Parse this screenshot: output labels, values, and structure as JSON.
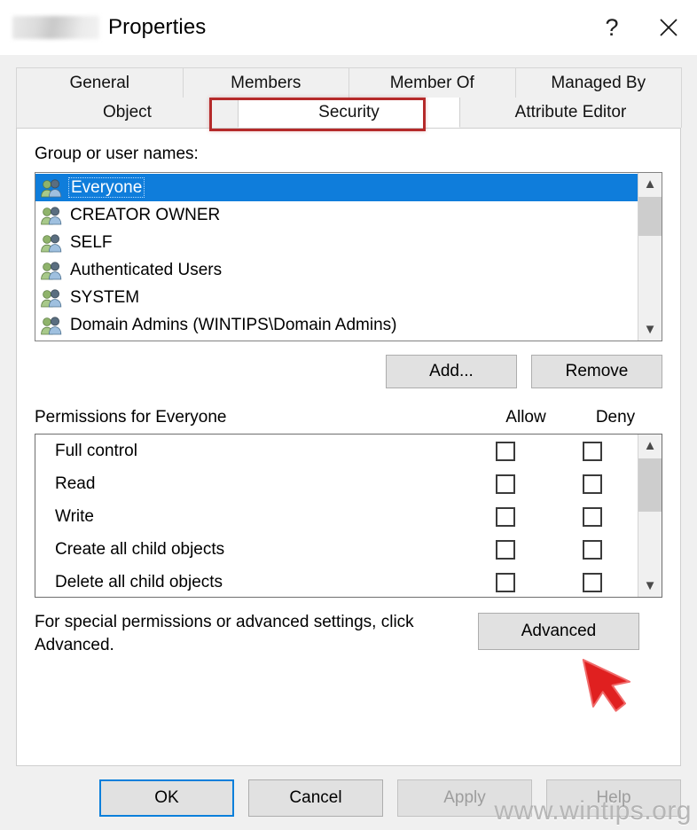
{
  "window": {
    "title_suffix": "Properties",
    "redacted_name": "",
    "help_icon": "?",
    "close_icon": "close-icon"
  },
  "tabs": {
    "row1": [
      {
        "label": "General",
        "selected": false
      },
      {
        "label": "Members",
        "selected": false
      },
      {
        "label": "Member Of",
        "selected": false
      },
      {
        "label": "Managed By",
        "selected": false
      }
    ],
    "row2": [
      {
        "label": "Object",
        "selected": false
      },
      {
        "label": "Security",
        "selected": true
      },
      {
        "label": "Attribute Editor",
        "selected": false
      }
    ],
    "highlight_color": "#b52a2a"
  },
  "security": {
    "group_label": "Group or user names:",
    "groups": [
      {
        "name": "Everyone",
        "selected": true
      },
      {
        "name": "CREATOR OWNER",
        "selected": false
      },
      {
        "name": "SELF",
        "selected": false
      },
      {
        "name": "Authenticated Users",
        "selected": false
      },
      {
        "name": "SYSTEM",
        "selected": false
      },
      {
        "name": "Domain Admins (WINTIPS\\Domain Admins)",
        "selected": false
      }
    ],
    "add_label": "Add...",
    "remove_label": "Remove",
    "permissions_title": "Permissions for Everyone",
    "column_allow": "Allow",
    "column_deny": "Deny",
    "permissions": [
      {
        "name": "Full control",
        "allow": false,
        "deny": false
      },
      {
        "name": "Read",
        "allow": false,
        "deny": false
      },
      {
        "name": "Write",
        "allow": false,
        "deny": false
      },
      {
        "name": "Create all child objects",
        "allow": false,
        "deny": false
      },
      {
        "name": "Delete all child objects",
        "allow": false,
        "deny": false
      }
    ],
    "advanced_text": "For special permissions or advanced settings, click Advanced.",
    "advanced_label": "Advanced"
  },
  "footer": {
    "ok_label": "OK",
    "cancel_label": "Cancel",
    "apply_label": "Apply",
    "help_label": "Help"
  },
  "watermark": "www.wintips.org",
  "colors": {
    "selection_blue": "#0f7ddb",
    "annotation_red": "#b52a2a",
    "cursor_red": "#e02020",
    "focus_blue": "#0a7fdb"
  }
}
